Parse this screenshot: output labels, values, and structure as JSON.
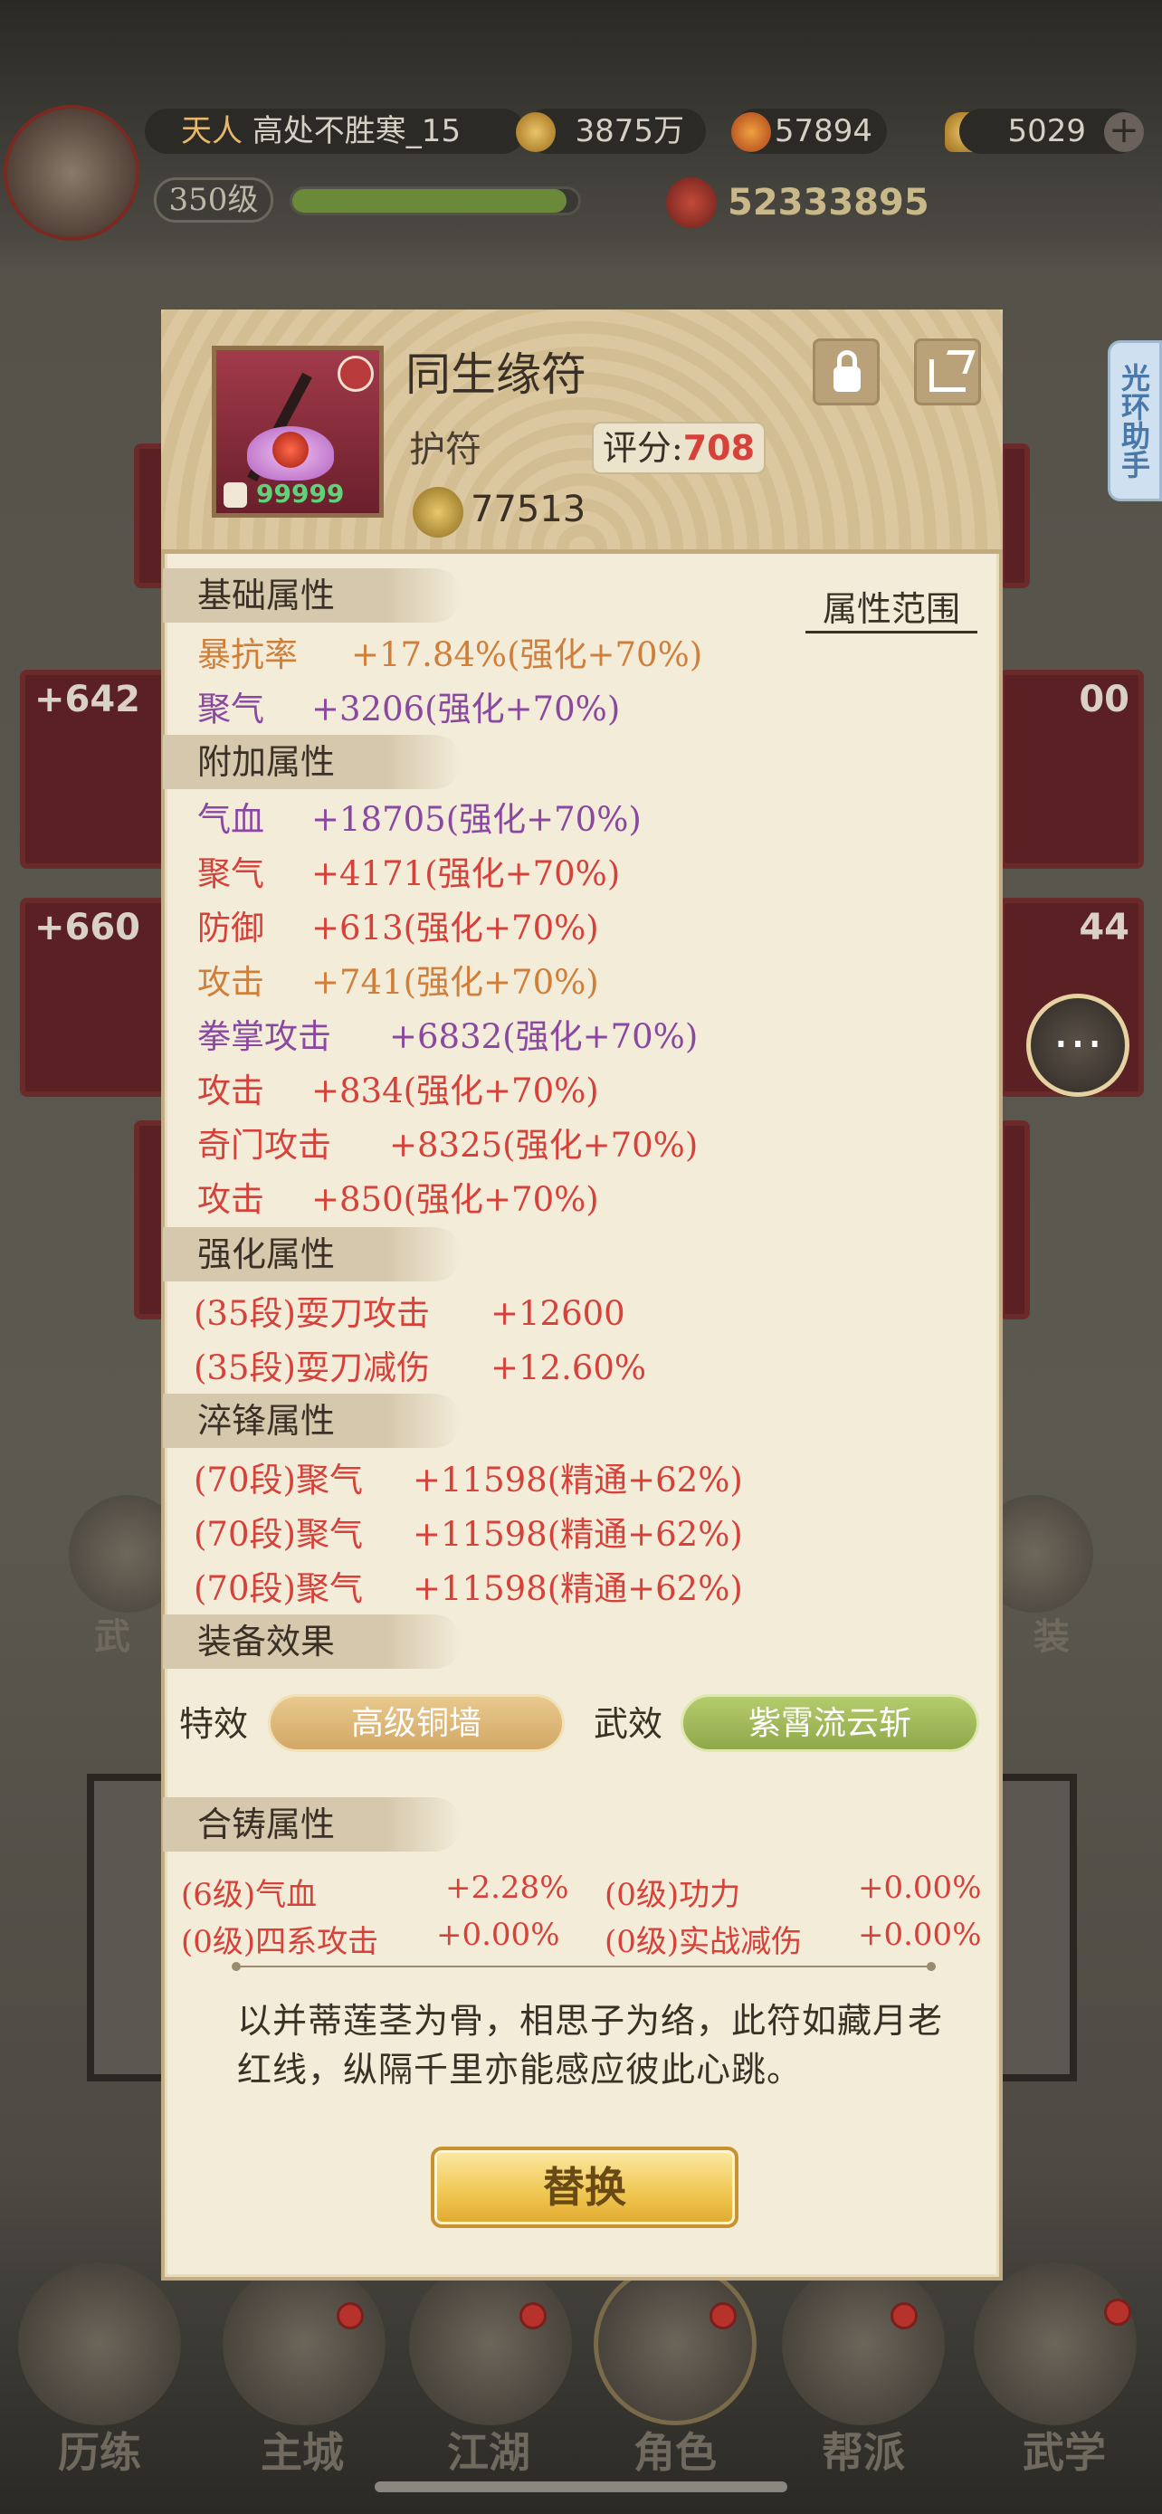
{
  "topbar": {
    "rank_badge": "天人",
    "player_name": "高处不胜寒_15",
    "level": "350级",
    "copper": "3875万",
    "resource2": "57894",
    "gold": "5029",
    "power": "52333895"
  },
  "background": {
    "card_values": [
      "+642",
      "+660",
      "00",
      "44"
    ],
    "left_btn": "武",
    "right_btn": "装",
    "helper_label": "光环助手"
  },
  "bottom_nav": [
    "历练",
    "主城",
    "江湖",
    "角色",
    "帮派",
    "武学"
  ],
  "item": {
    "name": "同生缘符",
    "type": "护符",
    "score_label": "评分:",
    "score": "708",
    "icon_level": "99999",
    "currency": "77513",
    "range_button": "属性范围"
  },
  "sections": {
    "base": "基础属性",
    "extra": "附加属性",
    "enhance": "强化属性",
    "temper": "淬锋属性",
    "effect": "装备效果",
    "fusion": "合铸属性"
  },
  "base_attrs": [
    {
      "name": "暴抗率",
      "value": "+17.84%(强化+70%)",
      "color": "orange"
    },
    {
      "name": "聚气",
      "value": "+3206(强化+70%)",
      "color": "purple"
    }
  ],
  "extra_attrs": [
    {
      "name": "气血",
      "value": "+18705(强化+70%)",
      "color": "purple"
    },
    {
      "name": "聚气",
      "value": "+4171(强化+70%)",
      "color": "red"
    },
    {
      "name": "防御",
      "value": "+613(强化+70%)",
      "color": "red"
    },
    {
      "name": "攻击",
      "value": "+741(强化+70%)",
      "color": "orange"
    },
    {
      "name": "拳掌攻击",
      "value": "+6832(强化+70%)",
      "color": "purple"
    },
    {
      "name": "攻击",
      "value": "+834(强化+70%)",
      "color": "red"
    },
    {
      "name": "奇门攻击",
      "value": "+8325(强化+70%)",
      "color": "red"
    },
    {
      "name": "攻击",
      "value": "+850(强化+70%)",
      "color": "red"
    }
  ],
  "enhance_attrs": [
    {
      "name": "(35段)耍刀攻击",
      "value": "+12600"
    },
    {
      "name": "(35段)耍刀减伤",
      "value": "+12.60%"
    }
  ],
  "temper_attrs": [
    {
      "name": "(70段)聚气",
      "value": "+11598(精通+62%)"
    },
    {
      "name": "(70段)聚气",
      "value": "+11598(精通+62%)"
    },
    {
      "name": "(70段)聚气",
      "value": "+11598(精通+62%)"
    }
  ],
  "effects": {
    "special_label": "特效",
    "special_value": "高级铜墙",
    "martial_label": "武效",
    "martial_value": "紫霄流云斩"
  },
  "fusion_attrs": [
    {
      "name": "(6级)气血",
      "value": "+2.28%"
    },
    {
      "name": "(0级)功力",
      "value": "+0.00%"
    },
    {
      "name": "(0级)四系攻击",
      "value": "+0.00%"
    },
    {
      "name": "(0级)实战减伤",
      "value": "+0.00%"
    }
  ],
  "description": "以并蒂莲茎为骨，相思子为络，此符如藏月老红线，纵隔千里亦能感应彼此心跳。",
  "replace_button": "替换"
}
